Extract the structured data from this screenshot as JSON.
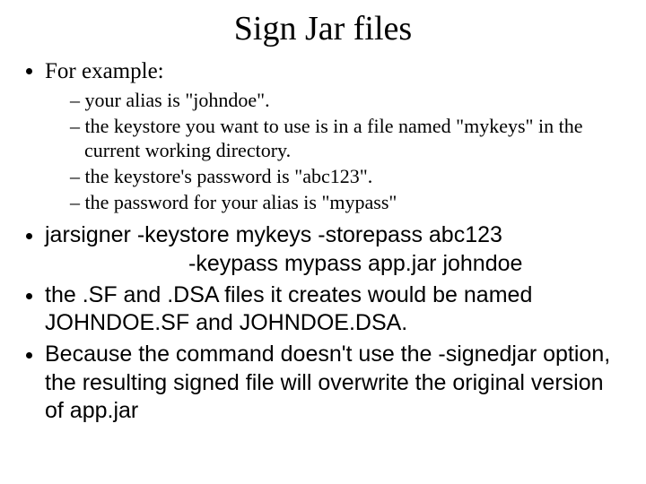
{
  "title": "Sign Jar files",
  "b1": "For example:",
  "s1": "your alias is \"johndoe\".",
  "s2": "the keystore you want to use is in a file named \"mykeys\" in the current working directory.",
  "s3": "the keystore's password is \"abc123\".",
  "s4": "the password for your alias is \"mypass\"",
  "cmd_line1": "jarsigner -keystore mykeys -storepass abc123",
  "cmd_line2": "-keypass mypass app.jar johndoe",
  "b3": "the .SF and .DSA files it creates would be named JOHNDOE.SF and JOHNDOE.DSA.",
  "b4": "Because the command doesn't use the -signedjar option, the resulting signed file will overwrite the original version of app.jar"
}
